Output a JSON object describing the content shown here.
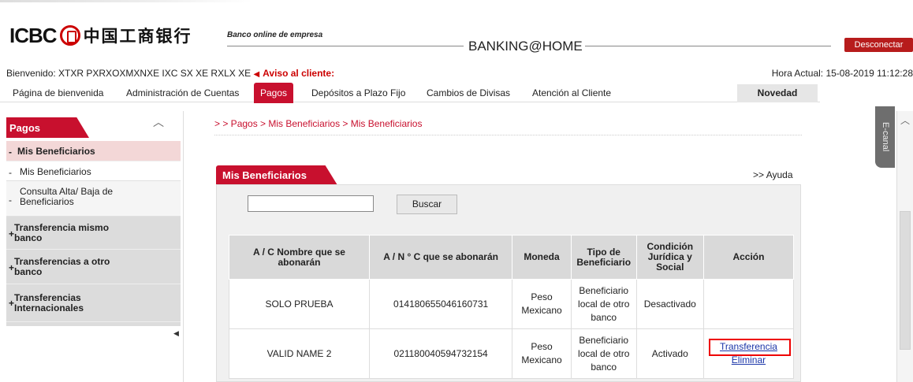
{
  "header": {
    "logo_latin": "ICBC",
    "logo_chinese": "中国工商银行",
    "slogan": "Banco online de empresa",
    "brand": "BANKING@HOME",
    "logout_label": "Desconectar",
    "welcome": "Bienvenido: XTXR PXRXOXMXNXE IXC SX XE RXLX XE",
    "alert": "Aviso al cliente:",
    "clock": "Hora Actual: 15-08-2019 11:12:28"
  },
  "menu": {
    "items": [
      "Página de bienvenida",
      "Administración de Cuentas",
      "Pagos",
      "Depósitos a Plazo Fijo",
      "Cambios de Divisas",
      "Atención al Cliente"
    ],
    "active": "Pagos",
    "novedad": "Novedad"
  },
  "sidebar": {
    "title": "Pagos",
    "items": [
      {
        "mark": "-",
        "label": "Mis Beneficiarios"
      },
      {
        "mark": "-",
        "label": "Mis Beneficiarios"
      },
      {
        "mark": "-",
        "label": "Consulta Alta/ Baja de Beneficiarios"
      },
      {
        "mark": "+",
        "label": "Transferencia mismo banco"
      },
      {
        "mark": "+",
        "label": "Transferencias a otro banco"
      },
      {
        "mark": "+",
        "label": "Transferencias Internacionales"
      }
    ]
  },
  "main": {
    "breadcrumb": "> > Pagos > Mis Beneficiarios > Mis Beneficiarios",
    "help": ">> Ayuda",
    "panel_title": "Mis Beneficiarios",
    "search_value": "",
    "search_button": "Buscar",
    "columns": [
      "A / C Nombre que se abonarán",
      "A / N ° C que se abonarán",
      "Moneda",
      "Tipo de Beneficiario",
      "Condición Jurídica y Social",
      "Acción"
    ],
    "rows": [
      {
        "name": "SOLO PRUEBA",
        "account": "014180655046160731",
        "currency": "Peso Mexicano",
        "type": "Beneficiario local de otro banco",
        "status": "Desactivado",
        "actions": []
      },
      {
        "name": "VALID NAME 2",
        "account": "021180040594732154",
        "currency": "Peso Mexicano",
        "type": "Beneficiario local de otro banco",
        "status": "Activado",
        "actions": [
          "Transferencia",
          "Eliminar"
        ]
      }
    ]
  },
  "right_rail": {
    "ecanal": "E-canal"
  },
  "colors": {
    "brand_red": "#c8102e",
    "link_blue": "#1a35a8",
    "highlight": "#e00000"
  }
}
